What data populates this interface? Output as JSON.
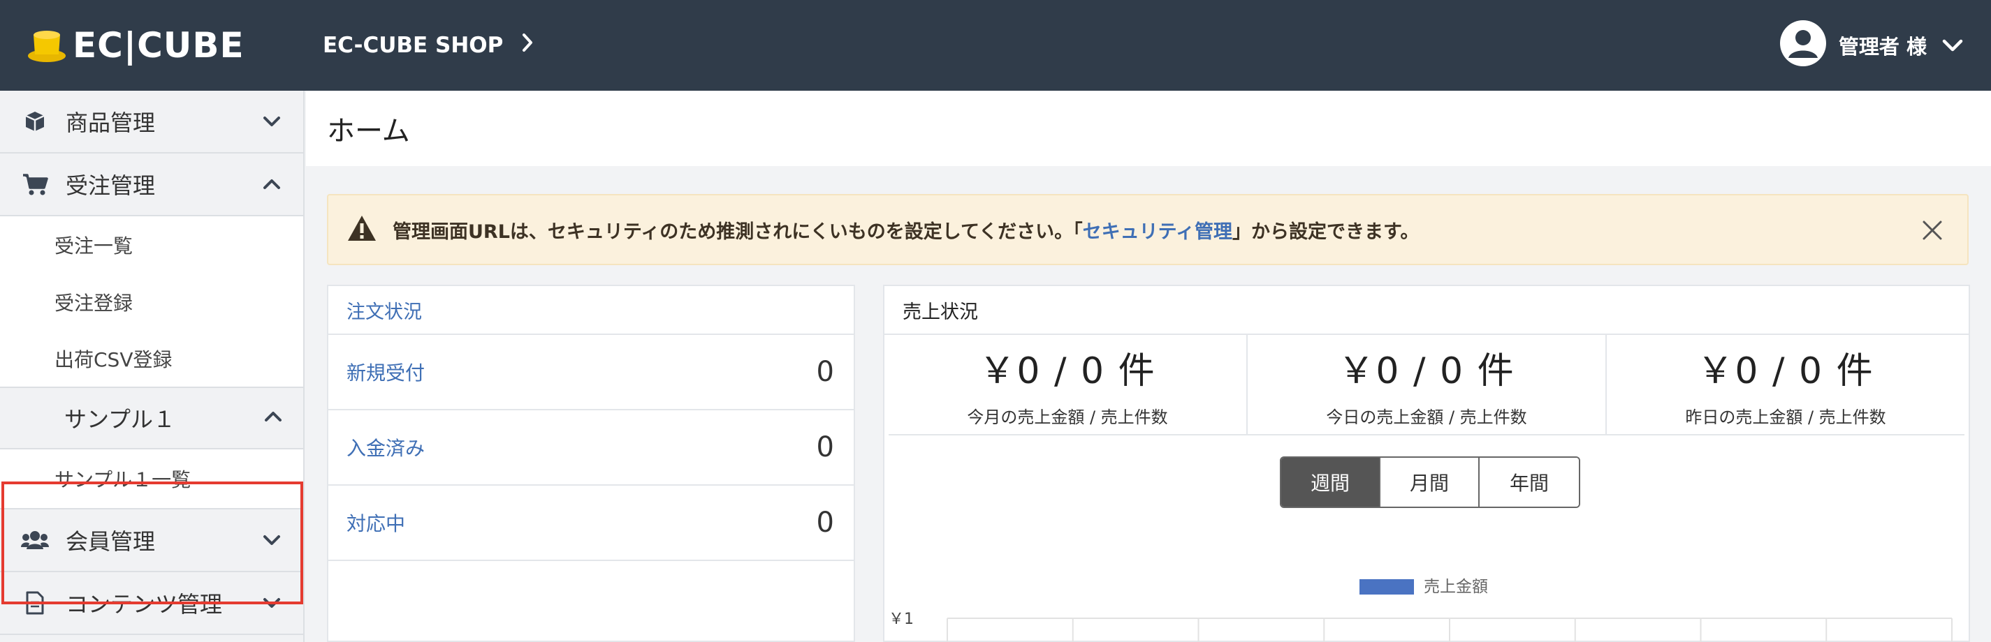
{
  "header": {
    "logo_text": "EC|CUBE",
    "shop_name": "EC-CUBE SHOP",
    "user_label": "管理者 様"
  },
  "sidebar": {
    "items": [
      {
        "label": "商品管理",
        "icon": "cube-icon",
        "expanded": false
      },
      {
        "label": "受注管理",
        "icon": "cart-icon",
        "expanded": true,
        "children": [
          "受注一覧",
          "受注登録",
          "出荷CSV登録"
        ]
      },
      {
        "label": "サンプル１",
        "expanded": true,
        "children": [
          "サンプル１一覧"
        ]
      },
      {
        "label": "会員管理",
        "icon": "users-icon",
        "expanded": false
      },
      {
        "label": "コンテンツ管理",
        "icon": "file-icon",
        "expanded": false
      }
    ]
  },
  "main": {
    "title": "ホーム",
    "alert": {
      "pre": "管理画面URLは、セキュリティのため推測されにくいものを設定してください。「",
      "link": "セキュリティ管理",
      "post": "」から設定できます。"
    },
    "order_status": {
      "title": "注文状況",
      "rows": [
        {
          "label": "新規受付",
          "count": "0"
        },
        {
          "label": "入金済み",
          "count": "0"
        },
        {
          "label": "対応中",
          "count": "0"
        }
      ]
    },
    "sales_status": {
      "title": "売上状況",
      "stats": [
        {
          "value": "￥0 / 0 件",
          "caption": "今月の売上金額 / 売上件数"
        },
        {
          "value": "￥0 / 0 件",
          "caption": "今日の売上金額 / 売上件数"
        },
        {
          "value": "￥0 / 0 件",
          "caption": "昨日の売上金額 / 売上件数"
        }
      ],
      "periods": [
        "週間",
        "月間",
        "年間"
      ],
      "active_period": "週間"
    }
  },
  "chart_data": {
    "type": "bar",
    "series": [
      {
        "name": "売上金額",
        "values": []
      }
    ],
    "ytick_top": "￥1",
    "legend": "top-center",
    "grid": true,
    "color": "#4a73c2"
  },
  "colors": {
    "header_bg": "#303c4a",
    "link": "#3f6fb5",
    "highlight_border": "#e53b30",
    "alert_bg": "#fbf1dd"
  }
}
